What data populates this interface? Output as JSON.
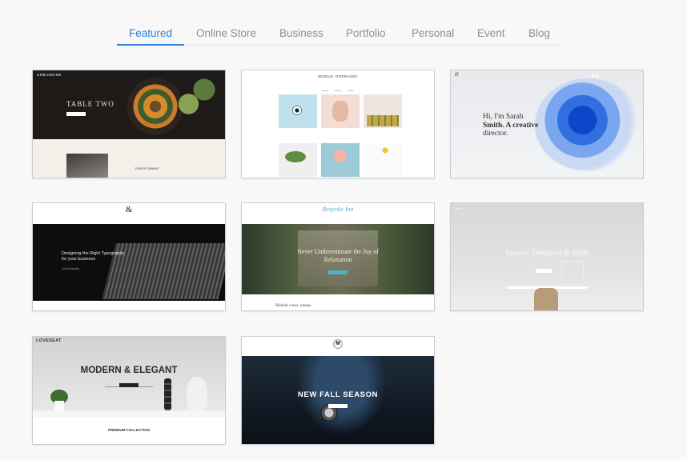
{
  "tabs": [
    {
      "label": "Featured",
      "active": true
    },
    {
      "label": "Online Store"
    },
    {
      "label": "Business"
    },
    {
      "label": "Portfolio"
    },
    {
      "label": "Personal"
    },
    {
      "label": "Event"
    },
    {
      "label": "Blog"
    }
  ],
  "templates": {
    "urbandine": {
      "logo": "URBANDINE",
      "hero_title": "TABLE TWO",
      "section_label": "DONTE DINING"
    },
    "modus": {
      "title": "MODUS OPERANDI"
    },
    "sarah": {
      "logo": "Ø",
      "intro_line1": "Hi, I'm Sarah",
      "intro_line2": "Smith. A creative",
      "intro_line3": "director."
    },
    "typography": {
      "logo": "&",
      "headline_line1": "Designing the Right Typography",
      "headline_line2": "for your business",
      "subline": "John Dornella"
    },
    "bespoke": {
      "logo": "Bespoke Inn",
      "headline_line1": "Never Underestimate the Joy of",
      "headline_line2": "Relaxation",
      "lower_heading": "Blissful views, unique"
    },
    "spaces": {
      "logo": "Brom",
      "headline": "Spaces: Designed & Built"
    },
    "loveseat": {
      "logo": "LOVESEAT",
      "headline": "MODERN & ELEGANT",
      "collection": "PREMIUM COLLECTION"
    },
    "fall": {
      "logo": "M",
      "headline": "NEW FALL SEASON"
    }
  },
  "colors": {
    "accent": "#2f7fd9",
    "tab_inactive": "#8a8f95"
  }
}
